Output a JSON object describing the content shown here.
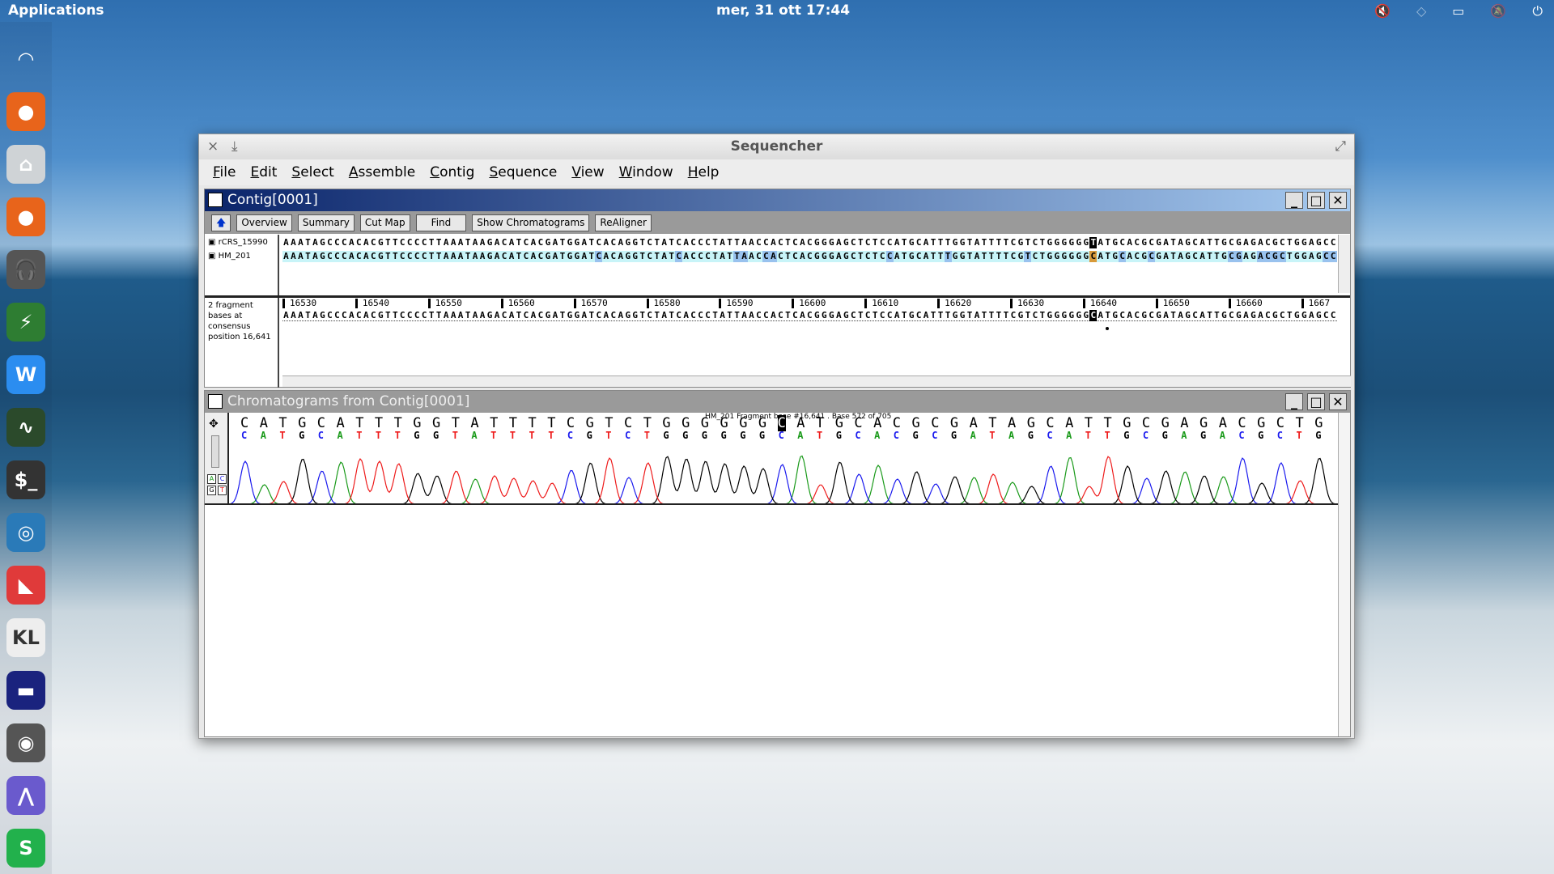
{
  "topbar": {
    "applications": "Applications",
    "datetime": "mer, 31 ott  17:44",
    "tray_icons": [
      "volume-muted-icon",
      "wifi-icon",
      "battery-icon",
      "notifications-off-icon",
      "power-icon"
    ]
  },
  "dock": {
    "items": [
      "wifi-icon",
      "firefox",
      "files",
      "firefox",
      "headphones",
      "book",
      "writer",
      "system-monitor",
      "terminal",
      "app",
      "pdf",
      "keyboard",
      "app",
      "chrome",
      "chromatogram-app",
      "spreadsheet"
    ]
  },
  "window": {
    "title": "Sequencher",
    "menu": [
      "File",
      "Edit",
      "Select",
      "Assemble",
      "Contig",
      "Sequence",
      "View",
      "Window",
      "Help"
    ]
  },
  "contig": {
    "title": "Contig[0001]",
    "toolbar": [
      "Overview",
      "Summary",
      "Cut Map",
      "Find",
      "Show Chromatograms",
      "ReAligner"
    ],
    "rows": [
      {
        "name": "rCRS_15990",
        "seq": "AAATAGCCCACACGTTCCCCTTAAATAAGACATCACGATGGATCACAGGTCTATCACCCTATTAACCACTCACGGGAGCTCTCCATGCATTTGGTATTTTCGTCTGGGGGGTATGCACGCGATAGCATTGCGAGACGCTGGAGCC",
        "selected": [
          111
        ]
      },
      {
        "name": "HM_201",
        "seq": "AAATAGCCCACACGTTCCCCTTAAATAAGACATCACGATGGATCACAGGTCTATCACCCTATTAACCACTCACGGGAGCTCTCCATGCATTTGGTATTTTCGTCTGGGGGGCATGCACGCGATAGCATTGCGAGACGCTGGAGCC",
        "edited": [
          43,
          54,
          62,
          63,
          66,
          67,
          83,
          91,
          102,
          115,
          119,
          130,
          131,
          134,
          135,
          136,
          137,
          143,
          144
        ],
        "conflict": [
          111
        ]
      }
    ],
    "consensus_info": "2 fragment bases at consensus position 16,641",
    "ruler": [
      "16530",
      "16540",
      "16550",
      "16560",
      "16570",
      "16580",
      "16590",
      "16600",
      "16610",
      "16620",
      "16630",
      "16640",
      "16650",
      "16660",
      "1667"
    ],
    "consensus": "AAATAGCCCACACGTTCCCCTTAAATAAGACATCACGATGGATCACAGGTCTATCACCCTATTAACCACTCACGGGAGCTCTCCATGCATTTGGTATTTTCGTCTGGGGGGCATGCACGCGATAGCATTGCGAGACGCTGGAGCC",
    "consensus_selected": 111
  },
  "chromatogram": {
    "title": "Chromatograms from Contig[0001]",
    "info": "HM_201 Fragment base #16,641 . Base 572 of 705",
    "bases": "CATGCATTTGGTATTTTCGTCTGGGGGGCATGCACGCGATAGCATTGCGAGACGCTG",
    "selected": 28,
    "base_colors": {
      "A": "#1a9a1a",
      "C": "#1a1aee",
      "G": "#000000",
      "T": "#ee1a1a"
    },
    "buttons": [
      "A",
      "C",
      "G",
      "T"
    ]
  },
  "colors": {
    "titlebar": "#0a246a",
    "edited": "#99c2ee",
    "conflict": "#d89a3a",
    "row_bg": "#c8f4f8"
  }
}
